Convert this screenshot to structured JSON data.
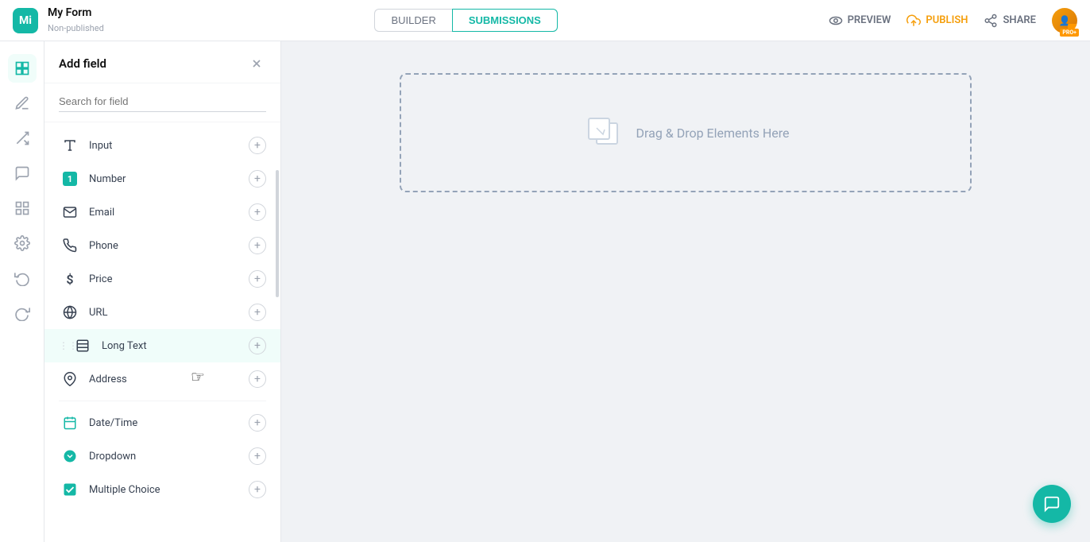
{
  "app": {
    "logo": "M",
    "form_name": "My Form",
    "form_status": "Non-published"
  },
  "tabs": {
    "builder_label": "BUILDER",
    "submissions_label": "SUBMISSIONS",
    "active": "submissions"
  },
  "topbar_actions": {
    "preview_label": "PREVIEW",
    "publish_label": "PUBLISH",
    "share_label": "SHARE"
  },
  "add_field_panel": {
    "title": "Add field",
    "search_placeholder": "Search for field",
    "close_icon": "×"
  },
  "fields": [
    {
      "id": "input",
      "label": "Input",
      "icon": "T",
      "icon_type": "text"
    },
    {
      "id": "number",
      "label": "Number",
      "icon": "1",
      "icon_type": "badge"
    },
    {
      "id": "email",
      "label": "Email",
      "icon": "✉",
      "icon_type": "text"
    },
    {
      "id": "phone",
      "label": "Phone",
      "icon": "📞",
      "icon_type": "text"
    },
    {
      "id": "price",
      "label": "Price",
      "icon": "$",
      "icon_type": "text"
    },
    {
      "id": "url",
      "label": "URL",
      "icon": "🌐",
      "icon_type": "text"
    },
    {
      "id": "longtext",
      "label": "Long Text",
      "icon": "⬜",
      "icon_type": "text",
      "has_drag": true
    },
    {
      "id": "address",
      "label": "Address",
      "icon": "📍",
      "icon_type": "text"
    },
    {
      "id": "datetime",
      "label": "Date/Time",
      "icon": "📅",
      "icon_type": "teal"
    },
    {
      "id": "dropdown",
      "label": "Dropdown",
      "icon": "⬇",
      "icon_type": "teal"
    },
    {
      "id": "multichoice",
      "label": "Multiple Choice",
      "icon": "✔",
      "icon_type": "teal"
    }
  ],
  "canvas": {
    "drop_text": "Drag & Drop Elements Here"
  },
  "sidebar_icons": [
    {
      "id": "layers",
      "icon": "⊞",
      "label": "layers-icon"
    },
    {
      "id": "pen",
      "icon": "✏",
      "label": "pen-icon"
    },
    {
      "id": "shuffle",
      "icon": "⇌",
      "label": "shuffle-icon"
    },
    {
      "id": "comment",
      "icon": "💬",
      "label": "comment-icon"
    },
    {
      "id": "grid",
      "icon": "⊞",
      "label": "grid-icon"
    },
    {
      "id": "settings",
      "icon": "⚙",
      "label": "settings-icon"
    },
    {
      "id": "undo",
      "icon": "↩",
      "label": "undo-icon"
    },
    {
      "id": "redo",
      "icon": "↪",
      "label": "redo-icon"
    }
  ]
}
